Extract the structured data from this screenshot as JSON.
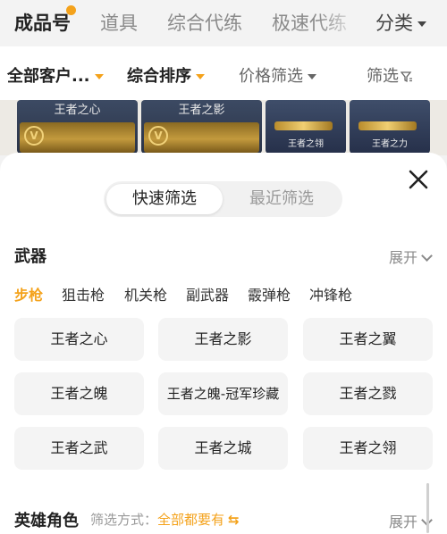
{
  "top_tabs": [
    "成品号",
    "道具",
    "综合代练",
    "极速代练",
    "分类"
  ],
  "filter_bar": {
    "customers": "全部客户...",
    "sort": "综合排序",
    "price": "价格筛选",
    "filter": "筛选"
  },
  "listing": {
    "cards": [
      "王者之心",
      "王者之影"
    ],
    "badge_letter": "V",
    "guns": [
      "王者之翎",
      "王者之力"
    ]
  },
  "sheet": {
    "tabs": {
      "quick": "快速筛选",
      "recent": "最近筛选"
    },
    "weapons": {
      "title": "武器",
      "expand": "展开",
      "categories": [
        "步枪",
        "狙击枪",
        "机关枪",
        "副武器",
        "霰弹枪",
        "冲锋枪"
      ],
      "items": [
        "王者之心",
        "王者之影",
        "王者之翼",
        "王者之魄",
        "王者之魄-冠军珍藏",
        "王者之戮",
        "王者之武",
        "王者之城",
        "王者之翎"
      ]
    },
    "heroes": {
      "title": "英雄角色",
      "filter_mode_label": "筛选方式：",
      "filter_mode_value": "全部都要有",
      "expand": "展开"
    }
  },
  "colors": {
    "accent": "#f4a21b",
    "chip_bg": "#f4f4f4"
  }
}
